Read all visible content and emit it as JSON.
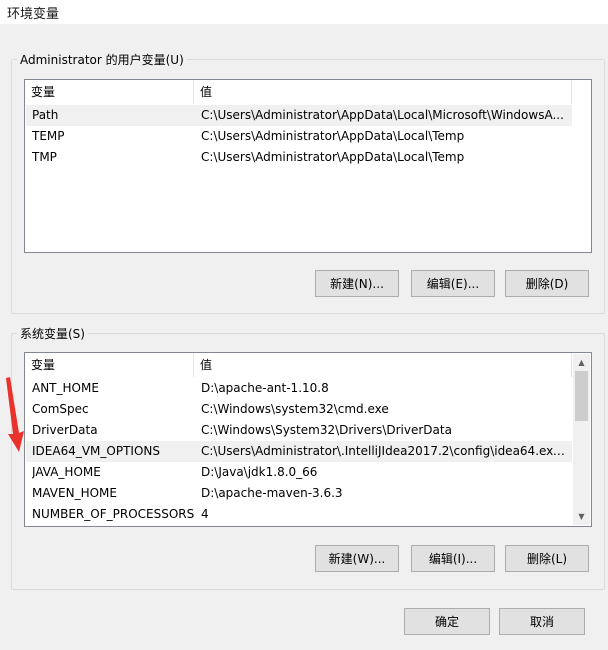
{
  "window": {
    "title": "环境变量"
  },
  "user_vars": {
    "legend": "Administrator 的用户变量(U)",
    "columns": [
      "变量",
      "值"
    ],
    "rows": [
      {
        "name": "Path",
        "value": "C:\\Users\\Administrator\\AppData\\Local\\Microsoft\\WindowsA..."
      },
      {
        "name": "TEMP",
        "value": "C:\\Users\\Administrator\\AppData\\Local\\Temp"
      },
      {
        "name": "TMP",
        "value": "C:\\Users\\Administrator\\AppData\\Local\\Temp"
      }
    ],
    "buttons": {
      "new": "新建(N)...",
      "edit": "编辑(E)...",
      "delete": "删除(D)"
    }
  },
  "system_vars": {
    "legend": "系统变量(S)",
    "columns": [
      "变量",
      "值"
    ],
    "rows": [
      {
        "name": "ANT_HOME",
        "value": "D:\\apache-ant-1.10.8"
      },
      {
        "name": "ComSpec",
        "value": "C:\\Windows\\system32\\cmd.exe"
      },
      {
        "name": "DriverData",
        "value": "C:\\Windows\\System32\\Drivers\\DriverData"
      },
      {
        "name": "IDEA64_VM_OPTIONS",
        "value": "C:\\Users\\Administrator\\.IntelliJIdea2017.2\\config\\idea64.exe...."
      },
      {
        "name": "JAVA_HOME",
        "value": "D:\\Java\\jdk1.8.0_66"
      },
      {
        "name": "MAVEN_HOME",
        "value": "D:\\apache-maven-3.6.3"
      },
      {
        "name": "NUMBER_OF_PROCESSORS",
        "value": "4"
      }
    ],
    "buttons": {
      "new": "新建(W)...",
      "edit": "编辑(I)...",
      "delete": "删除(L)"
    }
  },
  "footer": {
    "ok": "确定",
    "cancel": "取消"
  },
  "colors": {
    "annotation_arrow": "#e8322b",
    "selected_row": "#f0f0f0"
  }
}
